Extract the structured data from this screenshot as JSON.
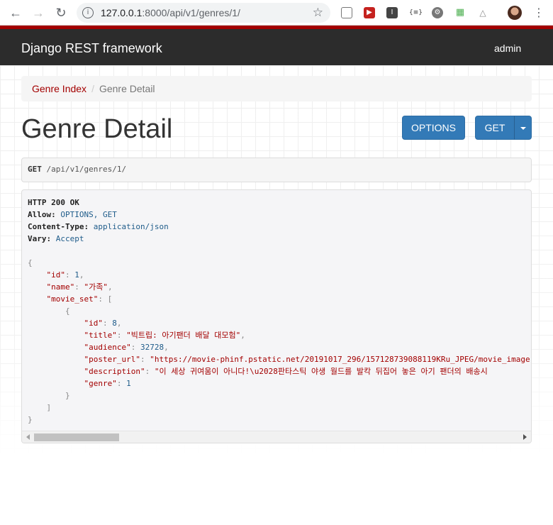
{
  "browser": {
    "url_host": "127.0.0.1",
    "url_rest": ":8000/api/v1/genres/1/"
  },
  "navbar": {
    "brand": "Django REST framework",
    "user": "admin"
  },
  "breadcrumb": {
    "items": [
      "Genre Index",
      "Genre Detail"
    ],
    "separator": "/"
  },
  "page": {
    "title": "Genre Detail",
    "options_label": "OPTIONS",
    "get_label": "GET"
  },
  "request": {
    "method": "GET",
    "path": "/api/v1/genres/1/"
  },
  "response": {
    "status": "HTTP 200 OK",
    "headers": [
      {
        "name": "Allow",
        "value": "OPTIONS, GET"
      },
      {
        "name": "Content-Type",
        "value": "application/json"
      },
      {
        "name": "Vary",
        "value": "Accept"
      }
    ],
    "body": {
      "id": 1,
      "name": "가족",
      "movie_set": [
        {
          "id": 8,
          "title": "빅트립: 아기팬더 배달 대모험",
          "audience": 32728,
          "poster_url": "https://movie-phinf.pstatic.net/20191017_296/157128739088119KRu_JPEG/movie_image.",
          "description": "이 세상 귀여움이 아니다!\\u2028판타스틱 야생 월드를 발칵 뒤집어 놓은 아기 팬더의 배송시",
          "genre": 1
        }
      ]
    }
  },
  "colors": {
    "accent": "#a30000",
    "navbar_bg": "#2c2c2c",
    "button_primary": "#337ab7"
  }
}
